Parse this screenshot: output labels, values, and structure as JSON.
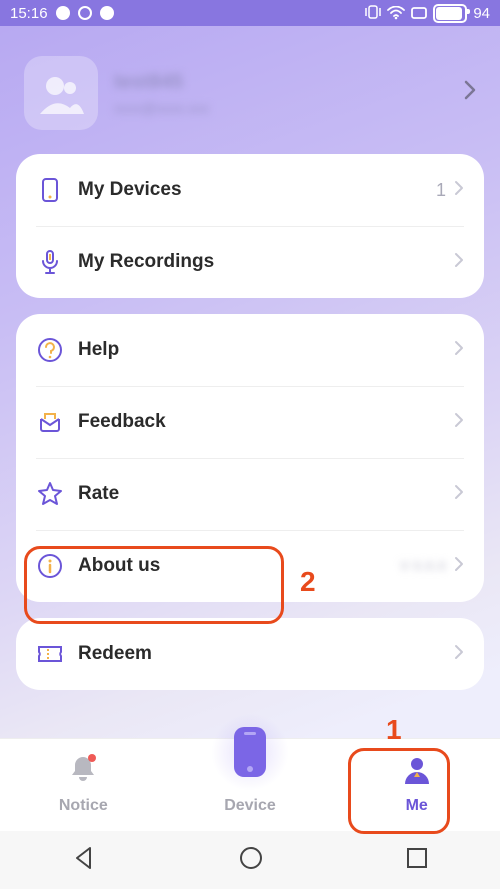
{
  "status": {
    "time": "15:16",
    "battery": "94"
  },
  "profile": {
    "name_obscured": "test845",
    "email_obscured": "xxxx@xxxx.xxx"
  },
  "section1": {
    "devices": {
      "label": "My Devices",
      "count": "1"
    },
    "recordings": {
      "label": "My Recordings"
    }
  },
  "section2": {
    "help": {
      "label": "Help"
    },
    "feedback": {
      "label": "Feedback"
    },
    "rate": {
      "label": "Rate"
    },
    "about": {
      "label": "About us",
      "version_obscured": "v x.x.x"
    }
  },
  "section3": {
    "redeem": {
      "label": "Redeem"
    }
  },
  "tabs": {
    "notice": "Notice",
    "device": "Device",
    "me": "Me"
  },
  "annotations": {
    "num1": "1",
    "num2": "2"
  }
}
